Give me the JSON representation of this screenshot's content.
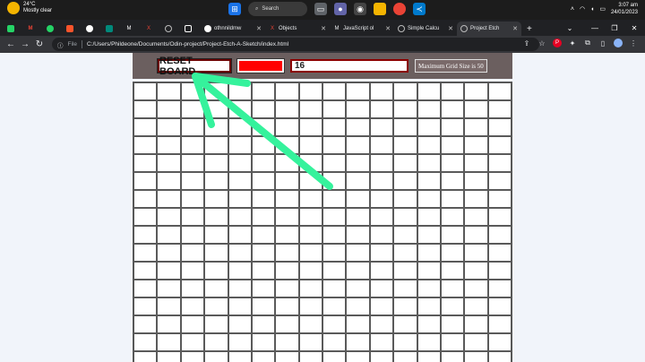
{
  "taskbar": {
    "weather_temp": "24°C",
    "weather_desc": "Mostly clear",
    "search_label": "Search",
    "time": "3:07 am",
    "date": "24/01/2023"
  },
  "tabs": [
    {
      "label": "",
      "icon": "whatsapp-icon"
    },
    {
      "label": "M",
      "icon": "gmail-icon"
    },
    {
      "label": "",
      "icon": "whatsapp-icon"
    },
    {
      "label": "",
      "icon": "brave-icon"
    },
    {
      "label": "",
      "icon": "github-icon"
    },
    {
      "label": "",
      "icon": "meet-icon"
    },
    {
      "label": "",
      "icon": "medium-icon"
    },
    {
      "label": "",
      "icon": "x-icon"
    },
    {
      "label": "",
      "icon": "globe-icon"
    },
    {
      "label": "",
      "icon": "chatgpt-icon"
    },
    {
      "label": "othnnildmw",
      "icon": "github-icon"
    },
    {
      "label": "Objects",
      "icon": "x-icon"
    },
    {
      "label": "JavaScript ol",
      "icon": "medium-icon"
    },
    {
      "label": "Simple Calcu",
      "icon": "globe-icon"
    },
    {
      "label": "Project Etch",
      "icon": "globe-icon",
      "active": true
    }
  ],
  "browser": {
    "scheme": "File",
    "url": "C:/Users/Phildeone/Documents/Odin-project/Project-Etch-A-Sketch/index.html"
  },
  "app": {
    "reset_label": "RESET BOARD",
    "pen_color": "#ff0000",
    "grid_size_value": "16",
    "max_label": "Maximum Grid Size is 50",
    "grid_columns": 16,
    "grid_rows": 16,
    "annotation_color": "#35f29c"
  }
}
